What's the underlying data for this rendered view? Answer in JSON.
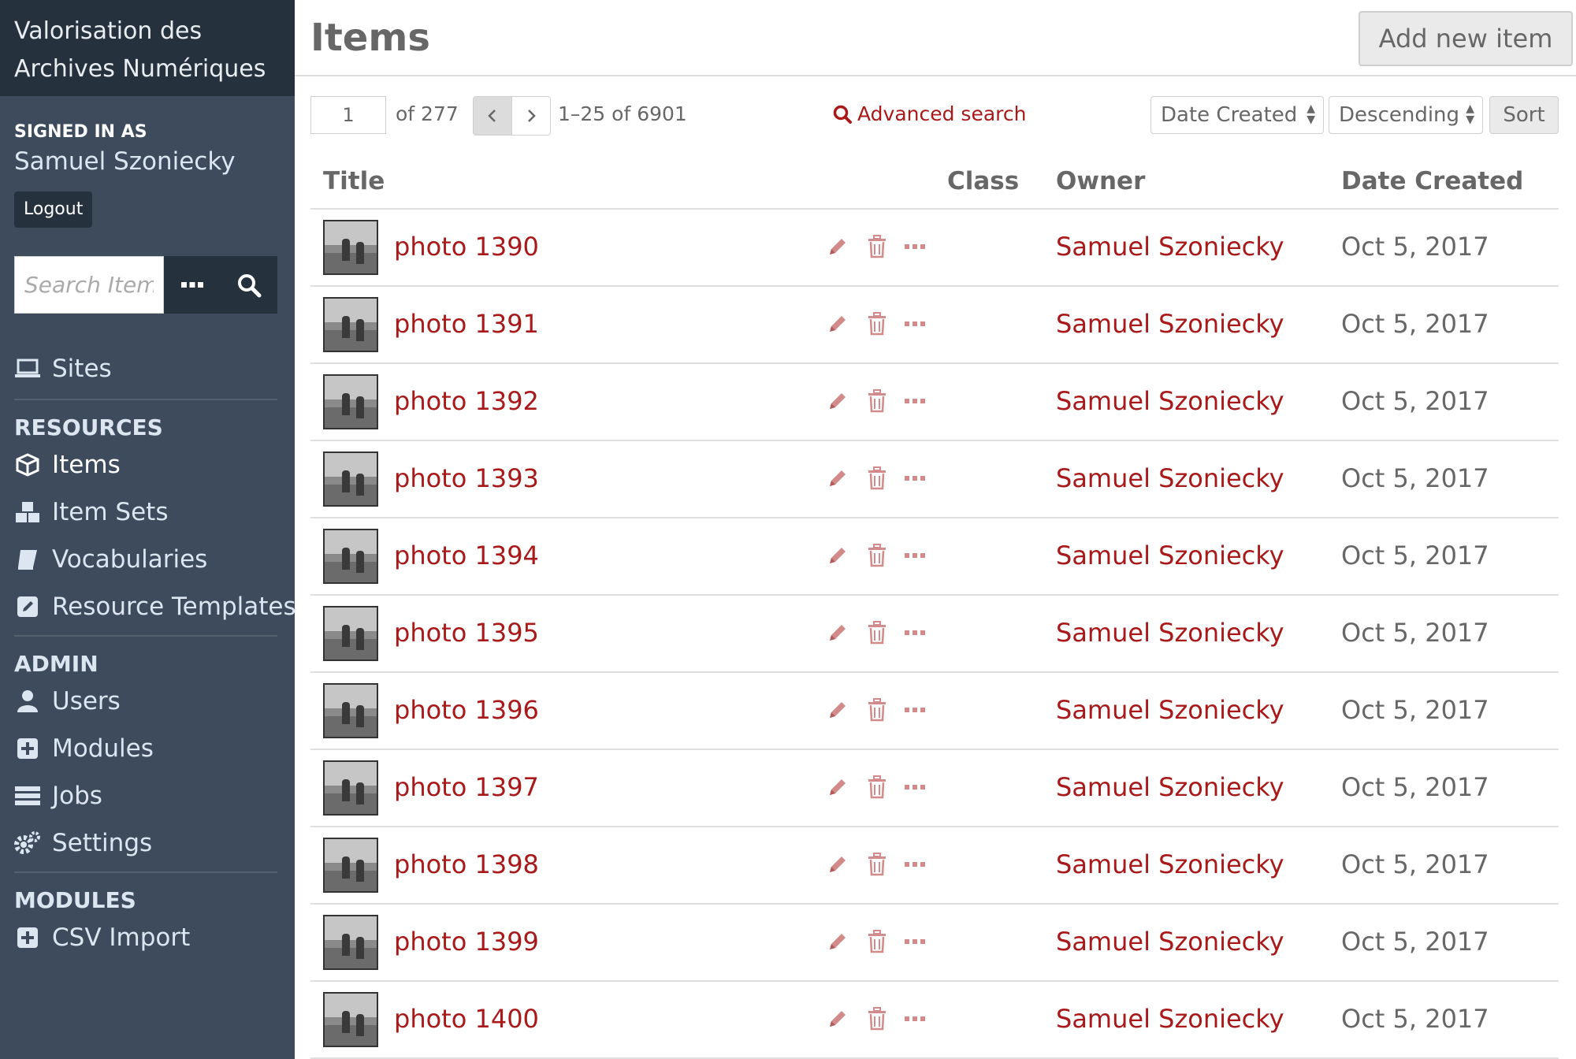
{
  "sidebar": {
    "brand": [
      "Valorisation des",
      "Archives Numériques"
    ],
    "signed_in_label": "SIGNED IN AS",
    "user_name": "Samuel Szoniecky",
    "logout_label": "Logout",
    "search_placeholder": "Search Items",
    "nav_sites": "Sites",
    "resources_heading": "RESOURCES",
    "resources": [
      {
        "label": "Items",
        "icon": "cube-icon"
      },
      {
        "label": "Item Sets",
        "icon": "cubes-icon"
      },
      {
        "label": "Vocabularies",
        "icon": "book-icon"
      },
      {
        "label": "Resource Templates",
        "icon": "edit-square-icon"
      }
    ],
    "admin_heading": "ADMIN",
    "admin": [
      {
        "label": "Users",
        "icon": "user-icon"
      },
      {
        "label": "Modules",
        "icon": "plus-square-icon"
      },
      {
        "label": "Jobs",
        "icon": "tasks-icon"
      },
      {
        "label": "Settings",
        "icon": "cogs-icon"
      }
    ],
    "modules_heading": "MODULES",
    "modules": [
      {
        "label": "CSV Import",
        "icon": "plus-square-icon"
      }
    ]
  },
  "header": {
    "title": "Items",
    "add_button": "Add new item"
  },
  "browse": {
    "page_value": "1",
    "of_pages": "of 277",
    "row_count": "1–25 of 6901",
    "advanced_search": "Advanced search",
    "sort_by": "Date Created",
    "sort_order": "Descending",
    "sort_button": "Sort"
  },
  "table": {
    "columns": [
      "Title",
      "Class",
      "Owner",
      "Date Created"
    ],
    "rows": [
      {
        "title": "photo 1390",
        "owner": "Samuel Szoniecky",
        "date": "Oct 5, 2017"
      },
      {
        "title": "photo 1391",
        "owner": "Samuel Szoniecky",
        "date": "Oct 5, 2017"
      },
      {
        "title": "photo 1392",
        "owner": "Samuel Szoniecky",
        "date": "Oct 5, 2017"
      },
      {
        "title": "photo 1393",
        "owner": "Samuel Szoniecky",
        "date": "Oct 5, 2017"
      },
      {
        "title": "photo 1394",
        "owner": "Samuel Szoniecky",
        "date": "Oct 5, 2017"
      },
      {
        "title": "photo 1395",
        "owner": "Samuel Szoniecky",
        "date": "Oct 5, 2017"
      },
      {
        "title": "photo 1396",
        "owner": "Samuel Szoniecky",
        "date": "Oct 5, 2017"
      },
      {
        "title": "photo 1397",
        "owner": "Samuel Szoniecky",
        "date": "Oct 5, 2017"
      },
      {
        "title": "photo 1398",
        "owner": "Samuel Szoniecky",
        "date": "Oct 5, 2017"
      },
      {
        "title": "photo 1399",
        "owner": "Samuel Szoniecky",
        "date": "Oct 5, 2017"
      },
      {
        "title": "photo 1400",
        "owner": "Samuel Szoniecky",
        "date": "Oct 5, 2017"
      }
    ]
  },
  "colors": {
    "sidebar_bg": "#3e4b5c",
    "sidebar_dark": "#25313d",
    "link_red": "#a91919",
    "text_gray": "#676767"
  }
}
